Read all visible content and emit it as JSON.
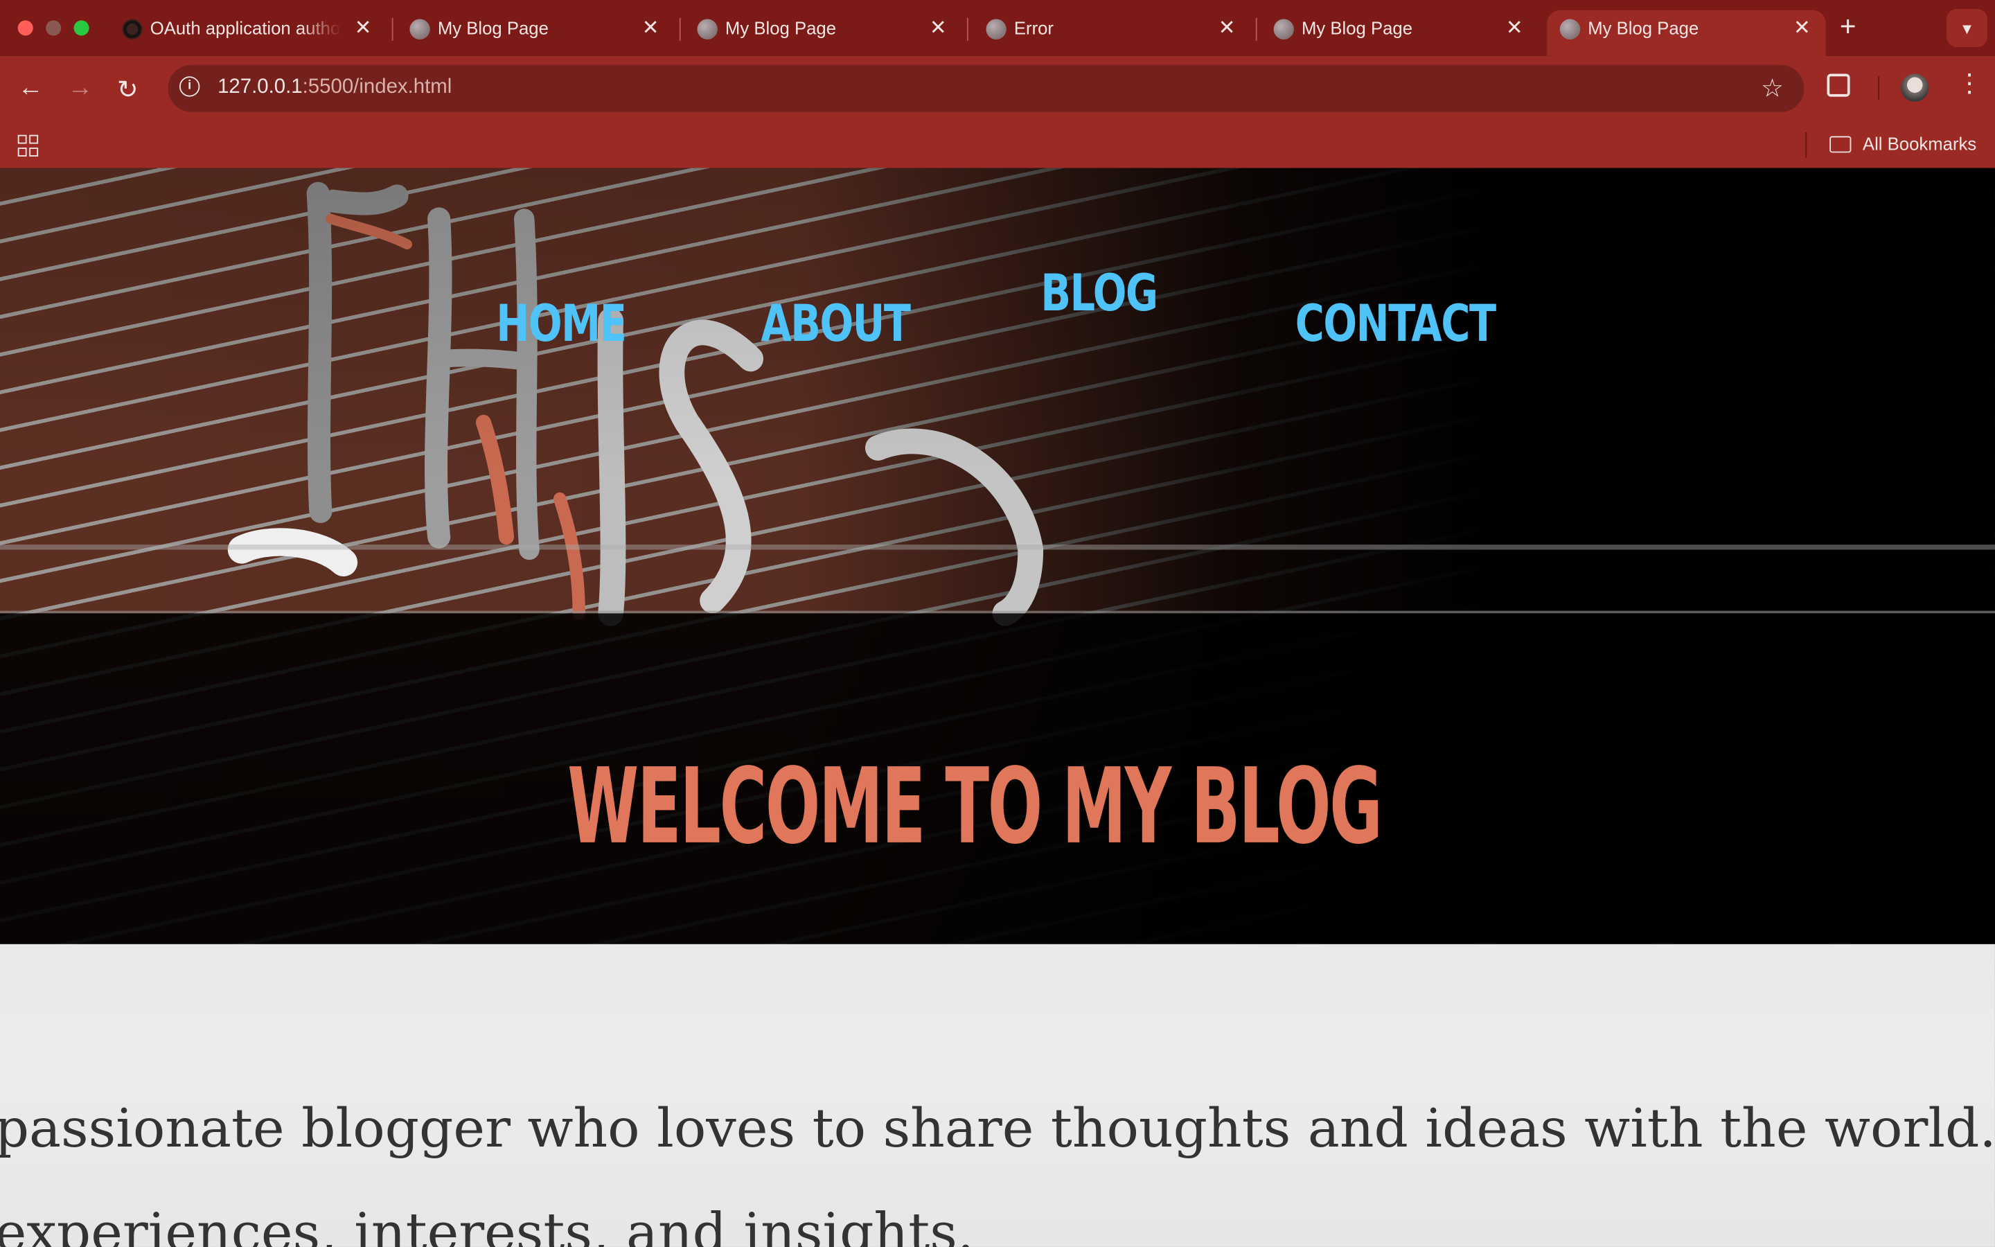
{
  "browser": {
    "tabs": [
      {
        "title": "OAuth application autho",
        "favicon": "github-icon",
        "active": false
      },
      {
        "title": "My Blog Page",
        "favicon": "globe-icon",
        "active": false
      },
      {
        "title": "My Blog Page",
        "favicon": "globe-icon",
        "active": false
      },
      {
        "title": "Error",
        "favicon": "globe-icon",
        "active": false
      },
      {
        "title": "My Blog Page",
        "favicon": "globe-icon",
        "active": false
      },
      {
        "title": "My Blog Page",
        "favicon": "globe-icon",
        "active": true
      }
    ],
    "address": {
      "host": "127.0.0.1",
      "rest": ":5500/index.html"
    },
    "bookmarks_label": "All Bookmarks",
    "theme_color": "#9b2a25"
  },
  "page": {
    "nav": {
      "home": "Home",
      "about": "About",
      "blog": "Blog",
      "contact": "Contact"
    },
    "hero_heading": "Welcome to my blog",
    "about_lines": [
      "passionate blogger who loves to share thoughts and ideas with the world. C",
      "experiences, interests, and insights."
    ],
    "colors": {
      "nav": "#4fc3f7",
      "heading": "#e0775a",
      "about_bg": "#e9e9e9"
    }
  }
}
